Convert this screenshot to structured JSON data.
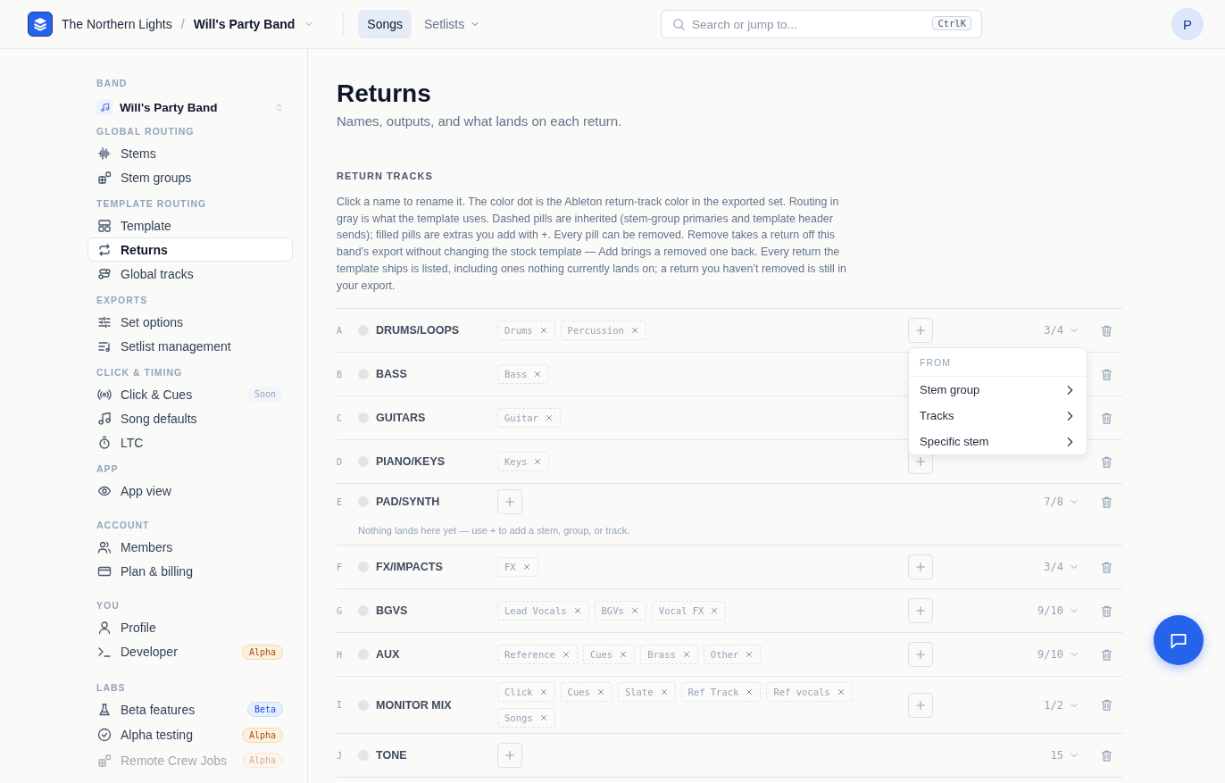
{
  "topbar": {
    "org": "The Northern Lights",
    "separator": "/",
    "band": "Will's Party Band",
    "tabs": [
      {
        "label": "Songs",
        "selected": true,
        "dropdown": false
      },
      {
        "label": "Setlists",
        "selected": false,
        "dropdown": true
      }
    ],
    "search": {
      "placeholder": "Search or jump to...",
      "shortcut": "CtrlK"
    },
    "avatar": "P"
  },
  "sidebar": {
    "band_heading": "BAND",
    "band_name": "Will's Party Band",
    "sections": [
      {
        "heading": "GLOBAL ROUTING",
        "items": [
          {
            "label": "Stems",
            "selected": false,
            "disabled": false
          },
          {
            "label": "Stem groups",
            "selected": false,
            "disabled": false
          }
        ]
      },
      {
        "heading": "TEMPLATE ROUTING",
        "items": [
          {
            "label": "Template",
            "selected": false,
            "disabled": false
          },
          {
            "label": "Returns",
            "selected": true,
            "disabled": false
          },
          {
            "label": "Global tracks",
            "selected": false,
            "disabled": false
          }
        ]
      },
      {
        "heading": "EXPORTS",
        "items": [
          {
            "label": "Set options",
            "selected": false,
            "disabled": false
          },
          {
            "label": "Setlist management",
            "selected": false,
            "disabled": false
          }
        ]
      },
      {
        "heading": "CLICK & TIMING",
        "items": [
          {
            "label": "Click & Cues",
            "selected": false,
            "disabled": false,
            "badge": {
              "text": "Soon",
              "kind": "soon"
            }
          },
          {
            "label": "Song defaults",
            "selected": false,
            "disabled": false
          },
          {
            "label": "LTC",
            "selected": false,
            "disabled": false
          }
        ]
      },
      {
        "heading": "APP",
        "items": [
          {
            "label": "App view",
            "selected": false,
            "disabled": false
          }
        ]
      },
      {
        "heading": "ACCOUNT",
        "items": [
          {
            "label": "Members",
            "selected": false,
            "disabled": false
          },
          {
            "label": "Plan & billing",
            "selected": false,
            "disabled": false
          }
        ]
      },
      {
        "heading": "YOU",
        "items": [
          {
            "label": "Profile",
            "selected": false,
            "disabled": false
          },
          {
            "label": "Developer",
            "selected": false,
            "disabled": false,
            "badge": {
              "text": "Alpha",
              "kind": "alpha"
            }
          }
        ]
      },
      {
        "heading": "LABS",
        "items": [
          {
            "label": "Beta features",
            "selected": false,
            "disabled": false,
            "badge": {
              "text": "Beta",
              "kind": "beta"
            }
          },
          {
            "label": "Alpha testing",
            "selected": false,
            "disabled": false,
            "badge": {
              "text": "Alpha",
              "kind": "alpha"
            }
          },
          {
            "label": "Remote Crew Jobs",
            "selected": false,
            "disabled": true,
            "badge": {
              "text": "Alpha",
              "kind": "alpha"
            }
          }
        ]
      }
    ]
  },
  "page": {
    "title": "Returns",
    "subtitle": "Names, outputs, and what lands on each return.",
    "section_heading": "RETURN TRACKS",
    "description": "Click a name to rename it. The color dot is the Ableton return-track color in the exported set. Routing in gray is what the template uses. Dashed pills are inherited (stem-group primaries and template header sends); filled pills are extras you add with +. Every pill can be removed. Remove takes a return off this band’s export without changing the stock template — Add brings a removed one back. Every return the template ships is listed, including ones nothing currently lands on; a return you haven’t removed is still in your export.",
    "returns": [
      {
        "letter": "A",
        "name": "DRUMS/LOOPS",
        "output": "3/4",
        "pills": [
          {
            "label": "Drums",
            "inherited": true
          },
          {
            "label": "Percussion",
            "inherited": true
          }
        ],
        "add_menu": {
          "header": "FROM",
          "items": [
            "Stem group",
            "Tracks",
            "Specific stem"
          ]
        }
      },
      {
        "letter": "B",
        "name": "BASS",
        "pills": [
          {
            "label": "Bass",
            "inherited": true
          }
        ]
      },
      {
        "letter": "C",
        "name": "GUITARS",
        "pills": [
          {
            "label": "Guitar",
            "inherited": true
          }
        ]
      },
      {
        "letter": "D",
        "name": "PIANO/KEYS",
        "pills": [
          {
            "label": "Keys",
            "inherited": true
          }
        ]
      },
      {
        "letter": "E",
        "name": "PAD/SYNTH",
        "output": "7/8",
        "note": "Nothing lands here yet — use + to add a stem, group, or track."
      },
      {
        "letter": "F",
        "name": "FX/IMPACTS",
        "output": "3/4",
        "pills": [
          {
            "label": "FX",
            "inherited": true
          }
        ]
      },
      {
        "letter": "G",
        "name": "BGVS",
        "output": "9/10",
        "pills": [
          {
            "label": "Lead Vocals",
            "inherited": true
          },
          {
            "label": "BGVs",
            "inherited": true
          },
          {
            "label": "Vocal FX",
            "inherited": true
          }
        ]
      },
      {
        "letter": "H",
        "name": "AUX",
        "output": "9/10",
        "pills": [
          {
            "label": "Reference",
            "inherited": true
          },
          {
            "label": "Cues",
            "inherited": true
          },
          {
            "label": "Brass",
            "inherited": true
          },
          {
            "label": "Other",
            "inherited": true
          }
        ]
      },
      {
        "letter": "I",
        "name": "MONITOR MIX",
        "output": "1/2",
        "pills": [
          {
            "label": "Click",
            "inherited": true
          },
          {
            "label": "Cues",
            "inherited": true
          },
          {
            "label": "Slate",
            "inherited": true
          },
          {
            "label": "Ref Track",
            "inherited": true
          },
          {
            "label": "Ref vocals",
            "inherited": true
          },
          {
            "label": "Songs",
            "inherited": true
          }
        ]
      },
      {
        "letter": "J",
        "name": "TONE",
        "output": "15"
      }
    ]
  }
}
